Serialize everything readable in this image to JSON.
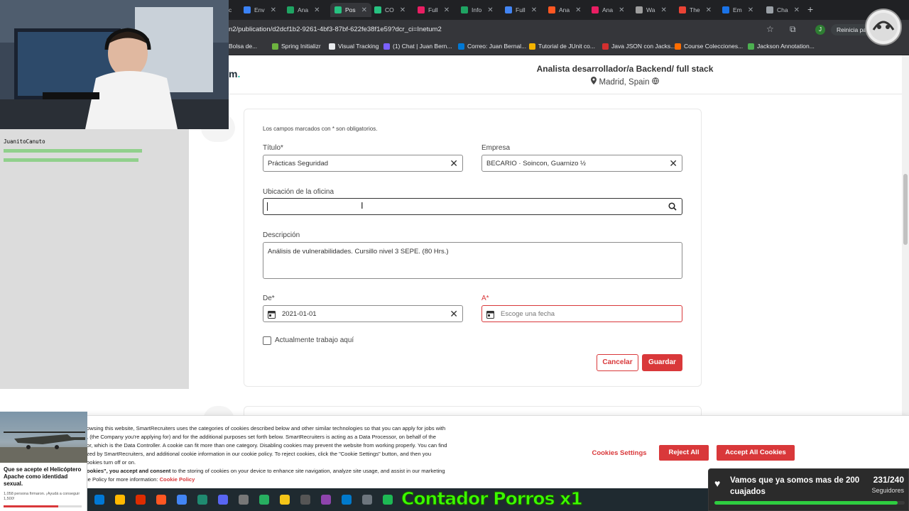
{
  "browser": {
    "tabs": [
      {
        "label": "c",
        "color": "#9aa0a6"
      },
      {
        "label": "Env",
        "color": "#3b82f6"
      },
      {
        "label": "Ana",
        "color": "#1fa463"
      },
      {
        "label": "Pos",
        "color": "#27c281",
        "active": true
      },
      {
        "label": "CO",
        "color": "#27c281"
      },
      {
        "label": "Full",
        "color": "#e91e63"
      },
      {
        "label": "Info",
        "color": "#1fa463"
      },
      {
        "label": "Full",
        "color": "#4285f4"
      },
      {
        "label": "Ana",
        "color": "#ff5722"
      },
      {
        "label": "Ana",
        "color": "#e91e63"
      },
      {
        "label": "Wa",
        "color": "#9e9e9e"
      },
      {
        "label": "The",
        "color": "#ea4335"
      },
      {
        "label": "Em",
        "color": "#1a73e8"
      },
      {
        "label": "Cha",
        "color": "#9aa0a6"
      }
    ],
    "url": "n2/publication/d2dcf1b2-9261-4bf3-87bf-622fe38f1e59?dcr_ci=Inetum2",
    "profile_initial": "J",
    "relaunch_label": "Reinicia pa",
    "bookmarks": [
      {
        "label": "Bolsa de...",
        "color": "#9aa0a6"
      },
      {
        "label": "Spring Initializr",
        "color": "#6db33f"
      },
      {
        "label": "Visual Tracking",
        "color": "#e8eaed"
      },
      {
        "label": "(1) Chat | Juan Bern...",
        "color": "#7b61ff"
      },
      {
        "label": "Correo: Juan Bernal...",
        "color": "#0078d4"
      },
      {
        "label": "Tutorial de JUnit co...",
        "color": "#f4b400"
      },
      {
        "label": "Java JSON con Jacks...",
        "color": "#d32f2f"
      },
      {
        "label": "Course Colecciones...",
        "color": "#ff6d00"
      },
      {
        "label": "Jackson Annotation...",
        "color": "#4caf50"
      }
    ]
  },
  "header": {
    "logo_fragment": "m",
    "logo_dot": ".",
    "job_title": "Analista desarrollador/a Backend/ full stack",
    "job_location": "Madrid, Spain"
  },
  "form": {
    "required_note": "Los campos marcados con * son obligatorios.",
    "title_label": "Título*",
    "title_value": "Prácticas Seguridad",
    "company_label": "Empresa",
    "company_value": "BECARIO · Soincon, Guarnizo ½",
    "office_label": "Ubicación de la oficina",
    "office_value": "",
    "description_label": "Descripción",
    "description_value": "Análisis de vulnerabilidades. Cursillo nivel 3 SEPE. (80 Hrs.)",
    "from_label": "De*",
    "from_value": "2021-01-01",
    "to_label": "A*",
    "to_placeholder": "Escoge una fecha",
    "current_job_label": "Actualmente trabajo aquí",
    "cancel_label": "Cancelar",
    "save_label": "Guardar"
  },
  "chat": [
    {
      "user": "JuanitoCanuto",
      "text": "",
      "color": "#000000"
    },
    {
      "user": "",
      "text": "",
      "color": "#35c12a"
    },
    {
      "user": "",
      "text": "",
      "color": "#35c12a"
    }
  ],
  "cookie": {
    "text_1": "owsing this website, SmartRecruiters uses the categories of cookies described below and other similar technologies so that you can apply for jobs with",
    "text_2": ", (the Company you're applying for) and for the additional purposes set forth below. SmartRecruiters is acting as a Data Processor, on behalf of the",
    "text_3": "or, which is the Data Controller. A cookie can fit more than one category. Disabling cookies may prevent the website from working properly. You can find",
    "text_4": "zed by SmartRecruiters, and additional cookie information in our cookie policy. To reject cookies, click the \"Cookie Settings\" button, and then you",
    "text_5": "ookies turn off or on.",
    "text_6_bold": "ookies\", you accept and consent",
    "text_6": " to the storing of cookies on your device to enhance site navigation, analyze site usage, and assist in our marketing",
    "text_7": "ie Policy for more information:",
    "policy_link": "Cookie Policy",
    "settings_label": "Cookies Settings",
    "reject_label": "Reject All",
    "accept_label": "Accept All Cookies"
  },
  "ad": {
    "title": "Que se acepte el Helicóptero Apache como identidad sexual.",
    "subtitle": "1,058 persona firmaron. ¡Ayudá a conseguir 1,500!",
    "progress": 0.7
  },
  "stream": {
    "counter_text": "Contador Porros x1",
    "follow_text": "Vamos que ya somos mas de 200 cuajados",
    "follow_count": "231/240",
    "follow_label": "Seguidores",
    "follow_progress": 0.9625
  },
  "colors": {
    "accent": "#d9383a",
    "brand_teal": "#1fbfa6"
  }
}
